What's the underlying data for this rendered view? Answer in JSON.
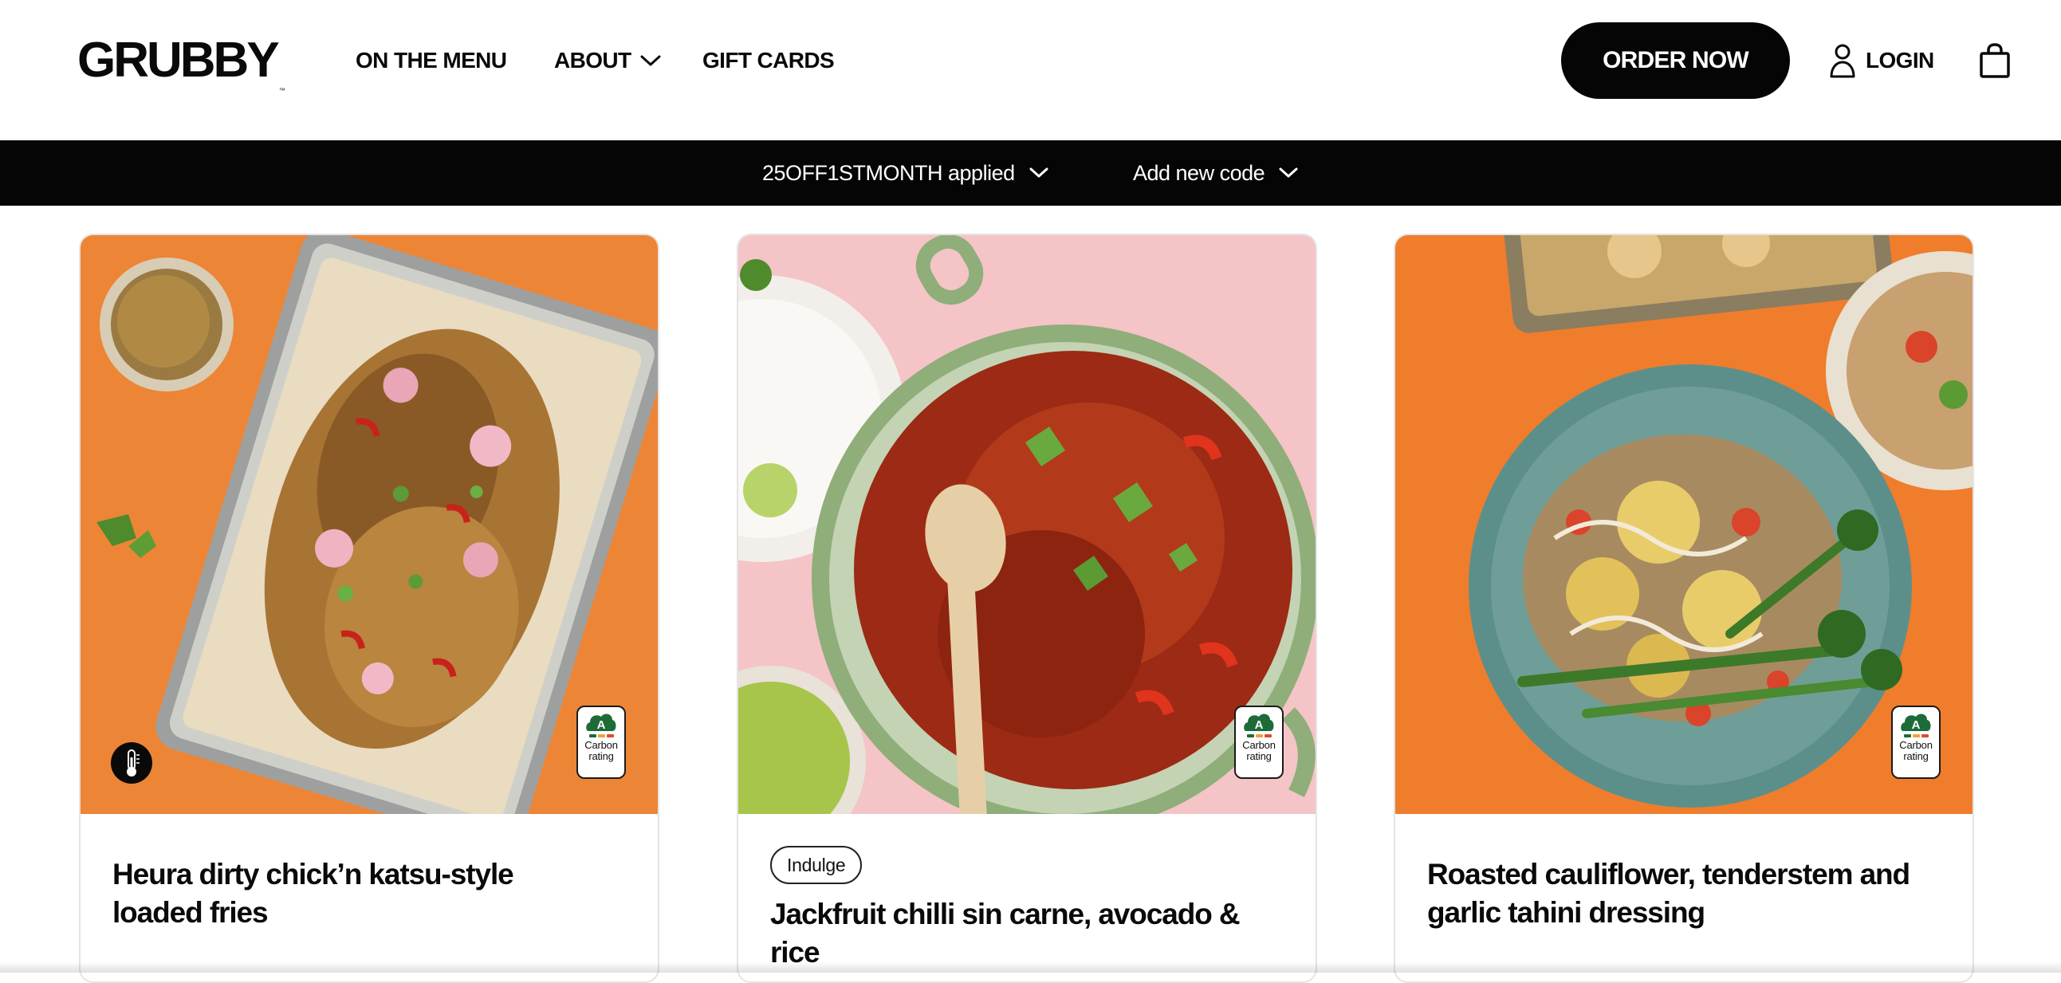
{
  "brand": {
    "name": "GRUBBY",
    "trademark": "™"
  },
  "nav": {
    "items": [
      {
        "label": "ON THE MENU"
      },
      {
        "label": "ABOUT"
      },
      {
        "label": "GIFT CARDS"
      }
    ],
    "order_label": "ORDER NOW",
    "login_label": "LOGIN"
  },
  "promo": {
    "applied_label": "25OFF1STMONTH applied",
    "add_label": "Add new code"
  },
  "icons": {
    "about_chevron": "chevron-down-icon",
    "user": "user-icon",
    "cart": "shopping-bag-icon",
    "promo_chevron": "chevron-down-icon",
    "carbon": "carbon-rating-icon",
    "thermometer": "thermometer-icon"
  },
  "colors": {
    "black": "#050505",
    "orange_bg": "#ef8a3a",
    "pink_bg": "#f4c4c6",
    "rating_green": "#1e6b3a"
  },
  "meals": [
    {
      "title": "Heura dirty chick’n katsu-style loaded fries",
      "tag": "",
      "carbon_grade": "A",
      "carbon_text": "Carbon rating",
      "has_thermometer_badge": true
    },
    {
      "title": "Jackfruit chilli sin carne, avocado & rice",
      "tag": "Indulge",
      "carbon_grade": "A",
      "carbon_text": "Carbon rating",
      "has_thermometer_badge": false
    },
    {
      "title": "Roasted cauliflower, tenderstem and garlic tahini dressing",
      "tag": "",
      "carbon_grade": "A",
      "carbon_text": "Carbon rating",
      "has_thermometer_badge": false
    }
  ]
}
